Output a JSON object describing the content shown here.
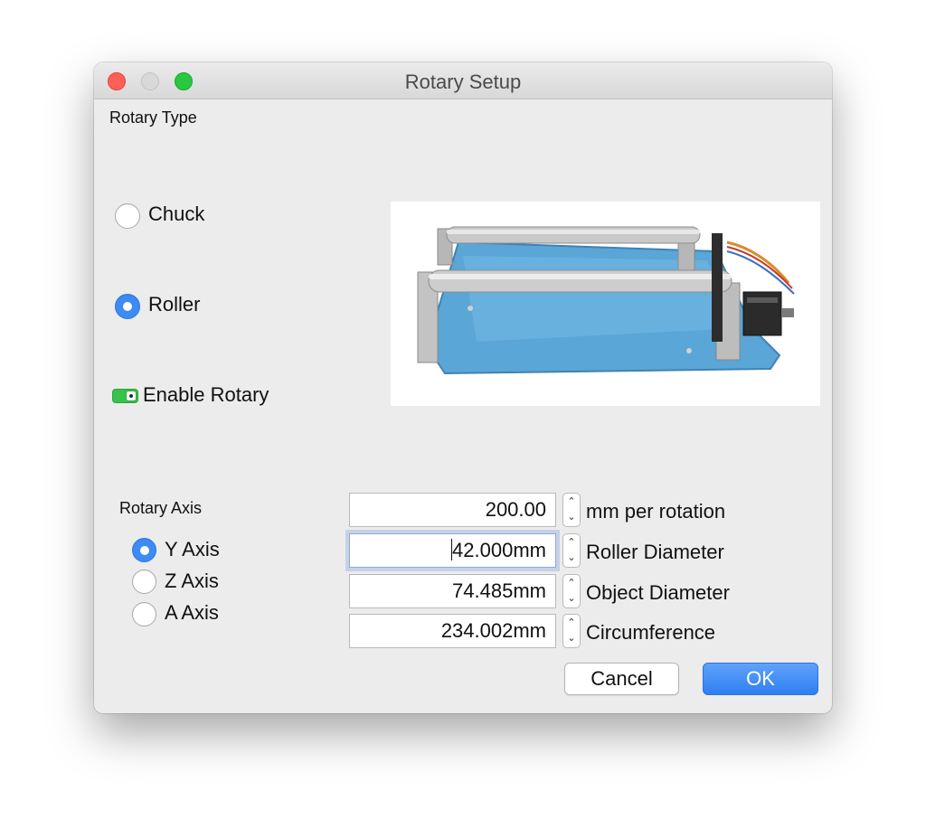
{
  "window": {
    "title": "Rotary Setup"
  },
  "rotary_type": {
    "label": "Rotary Type",
    "options": [
      {
        "label": "Chuck",
        "selected": false
      },
      {
        "label": "Roller",
        "selected": true
      }
    ],
    "enable_label": "Enable Rotary",
    "enabled": true
  },
  "rotary_axis": {
    "label": "Rotary Axis",
    "options": [
      {
        "label": "Y Axis",
        "selected": true
      },
      {
        "label": "Z Axis",
        "selected": false
      },
      {
        "label": "A Axis",
        "selected": false
      }
    ]
  },
  "fields": [
    {
      "value": "200.00",
      "label": "mm per rotation"
    },
    {
      "value": "42.000mm",
      "label": "Roller Diameter"
    },
    {
      "value": "74.485mm",
      "label": "Object Diameter"
    },
    {
      "value": "234.002mm",
      "label": "Circumference"
    }
  ],
  "buttons": {
    "cancel": "Cancel",
    "ok": "OK"
  },
  "colors": {
    "accent": "#3d8bf5",
    "toggle_on": "#36c34a",
    "close": "#fe5f57",
    "zoom": "#28c840"
  }
}
